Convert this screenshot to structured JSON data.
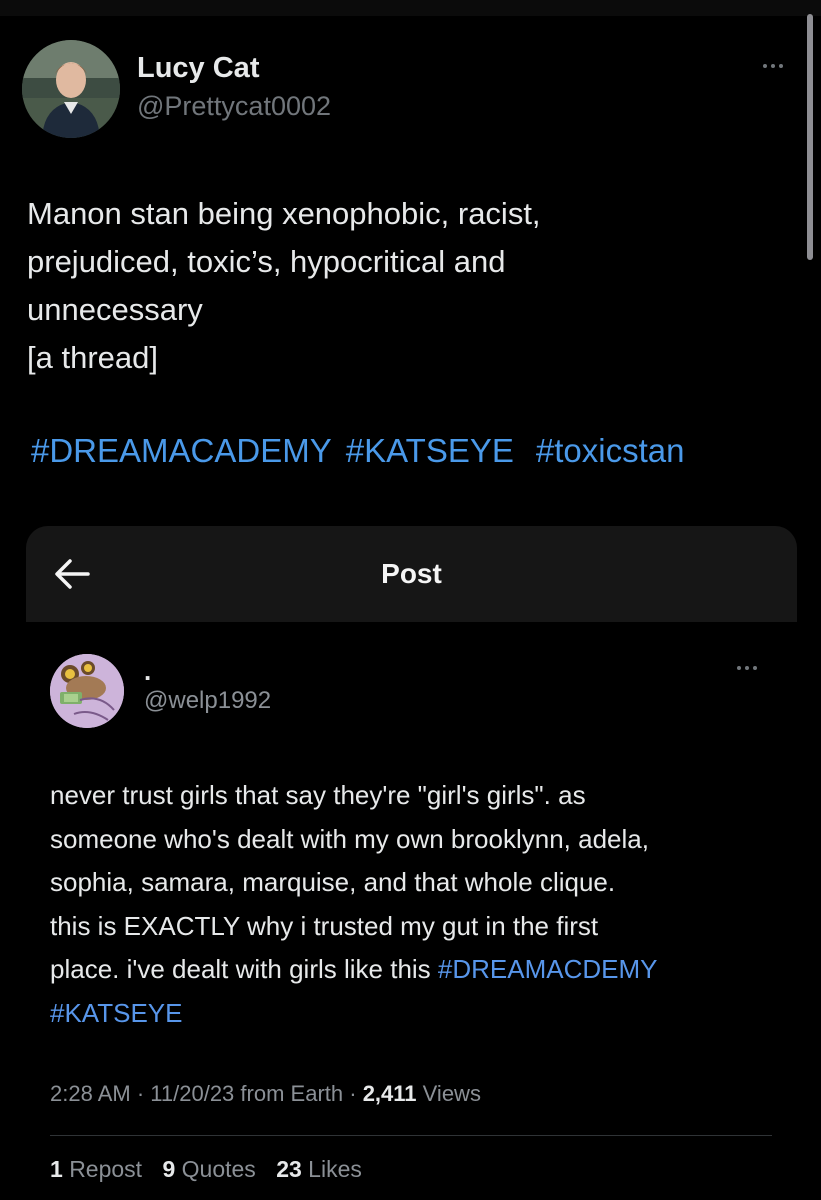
{
  "tweet": {
    "author_name": "Lucy Cat",
    "author_handle": "@Prettycat0002",
    "text_lines": [
      "Manon stan being xenophobic, racist,",
      "prejudiced, toxic’s, hypocritical and",
      "unnecessary",
      "[a thread]"
    ],
    "hashtags": [
      "#DREAMACADEMY",
      "#KATSEYE",
      "#toxicstan"
    ],
    "more_icon": "more-horizontal-icon"
  },
  "embedded_post": {
    "header_title": "Post",
    "back_icon": "arrow-left-icon",
    "author_name": ".",
    "author_handle": "@welp1992",
    "text_lines": [
      "never trust girls that say they're \"girl's girls\". as",
      "someone who's dealt with my own brooklynn, adela,",
      "sophia, samara, marquise, and that whole clique.",
      "this is EXACTLY why i trusted my gut in the first"
    ],
    "line5_prefix": "place. i've dealt with girls like this ",
    "hashtag_1": "#DREAMACDEMY",
    "hashtag_2": "#KATSEYE",
    "meta": {
      "time": "2:28 AM",
      "date": "11/20/23",
      "source": "from Earth",
      "views_count": "2,411",
      "views_label": "Views"
    },
    "stats": {
      "reposts_count": "1",
      "reposts_label": "Repost",
      "quotes_count": "9",
      "quotes_label": "Quotes",
      "likes_count": "23",
      "likes_label": "Likes"
    }
  },
  "colors": {
    "background": "#000000",
    "hashtag_blue": "#4a99e9",
    "secondary_text": "#71767b"
  }
}
